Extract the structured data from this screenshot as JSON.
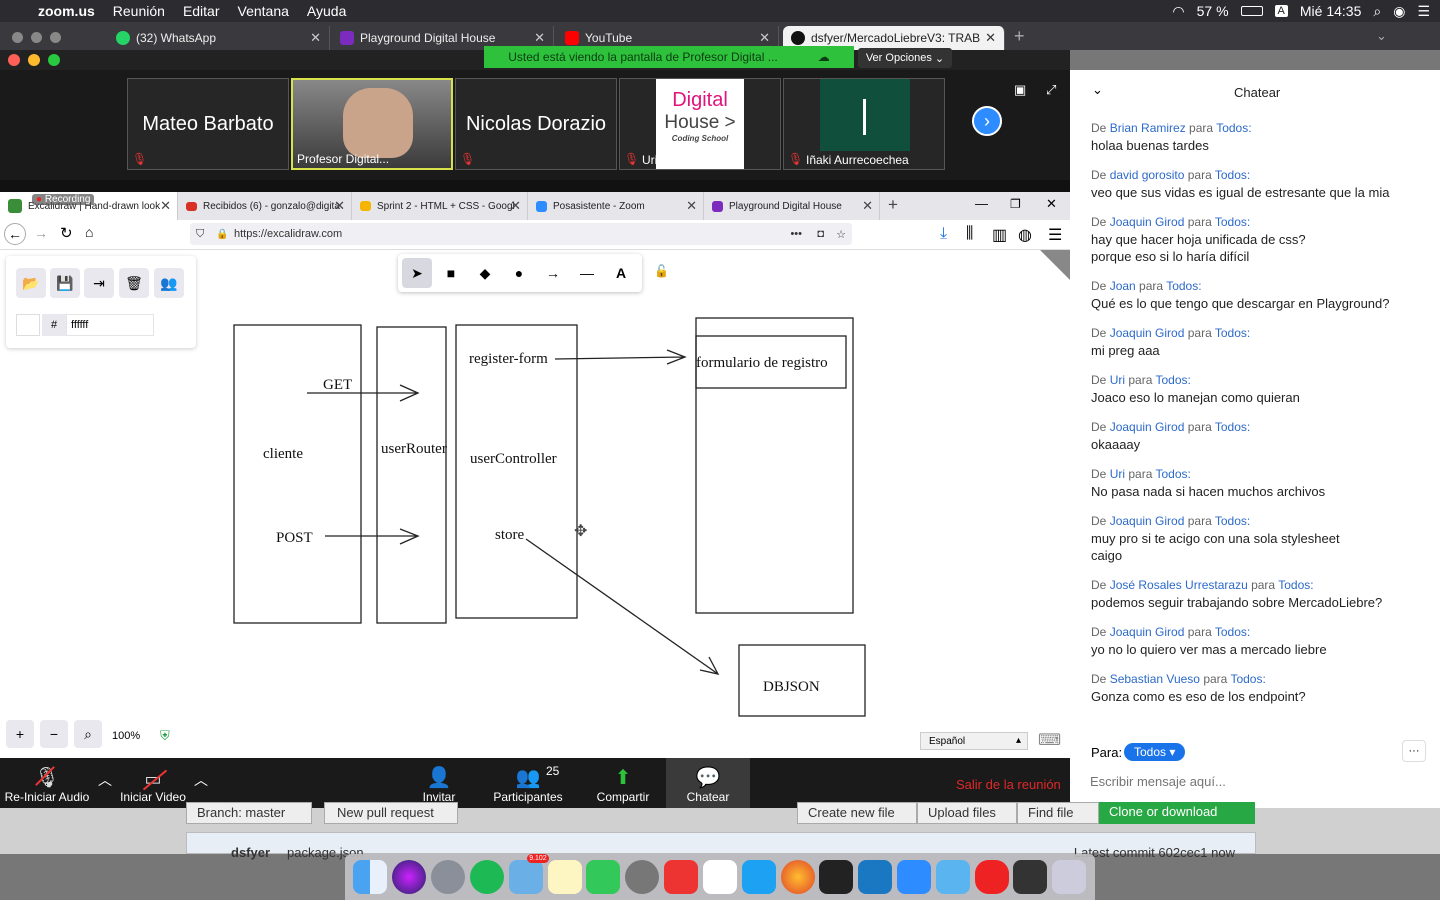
{
  "menubar": {
    "app": "zoom.us",
    "items": [
      "Reunión",
      "Editar",
      "Ventana",
      "Ayuda"
    ],
    "battery": "57 %",
    "clock": "Mié 14:35",
    "input_lang": "A"
  },
  "chrome_tabs": [
    {
      "label": "(32) WhatsApp",
      "badge": "32",
      "color": "#25d366"
    },
    {
      "label": "Playground Digital House",
      "color": "#7b2cbf"
    },
    {
      "label": "YouTube",
      "color": "#ff0000"
    },
    {
      "label": "dsfyer/MercadoLiebreV3: TRAB",
      "color": "#111111"
    }
  ],
  "zoom": {
    "share_banner": "Usted está viendo la pantalla de Profesor Digital ...",
    "view_options": "Ver Opciones"
  },
  "participants": [
    {
      "name": "Mateo Barbato",
      "label": ""
    },
    {
      "name": "",
      "label": "Profesor Digital..."
    },
    {
      "name": "Nicolas Dorazio",
      "label": ""
    },
    {
      "name": "",
      "label": "Uri",
      "logo": "Digital House > Coding School"
    },
    {
      "name": "",
      "label": "Iñaki Aurrecoechea"
    }
  ],
  "dh_logo": {
    "line1": "Digital",
    "line2": "House >",
    "line3": "Coding School"
  },
  "firefox": {
    "tabs": [
      {
        "label": "Excalidraw | Hand-drawn look"
      },
      {
        "label": "Recibidos (6) - gonzalo@digita"
      },
      {
        "label": "Sprint 2 - HTML + CSS - Googl"
      },
      {
        "label": "Posasistente - Zoom"
      },
      {
        "label": "Playground Digital House"
      }
    ],
    "recording": "Recording",
    "url": "https://excalidraw.com"
  },
  "excalidraw": {
    "color_value": "ffffff",
    "hash": "#",
    "zoom": "100%",
    "language": "Español",
    "shape_tools": [
      "selection",
      "rectangle",
      "diamond",
      "ellipse",
      "arrow",
      "line",
      "text"
    ],
    "labels": {
      "get": "GET",
      "cliente": "cliente",
      "post": "POST",
      "userRouter": "userRouter",
      "register_form": "register-form",
      "userController": "userController",
      "store": "store",
      "formulario": "formulario de registro",
      "dbjson": "DBJSON"
    }
  },
  "zoom_toolbar": {
    "audio": "Re-Iniciar Audio",
    "video": "Iniciar Video",
    "invite": "Invitar",
    "participants": "Participantes",
    "participants_count": "25",
    "share": "Compartir",
    "chat": "Chatear",
    "leave": "Salir de la reunión"
  },
  "chat": {
    "title": "Chatear",
    "messages": [
      {
        "pre": "De ",
        "from": "Brian Ramirez",
        "mid": " para ",
        "to": "Todos:",
        "text": "holaa buenas tardes"
      },
      {
        "pre": "De ",
        "from": "david gorosito",
        "mid": " para ",
        "to": "Todos:",
        "text": "veo que sus vidas es igual de estresante que la mia"
      },
      {
        "pre": "De ",
        "from": "Joaquin Girod",
        "mid": " para ",
        "to": "Todos:",
        "text": "hay que hacer hoja unificada de css?",
        "text2": "porque eso si lo haría difícil"
      },
      {
        "pre": "De ",
        "from": "Joan",
        "mid": " para ",
        "to": "Todos:",
        "text": "Qué es lo que tengo que descargar en Playground?"
      },
      {
        "pre": "De ",
        "from": "Joaquin Girod",
        "mid": " para ",
        "to": "Todos:",
        "text": "mi preg aaa"
      },
      {
        "pre": "De ",
        "from": "Uri",
        "mid": " para ",
        "to": "Todos:",
        "text": "Joaco eso lo manejan como quieran"
      },
      {
        "pre": "De ",
        "from": "Joaquin Girod",
        "mid": " para ",
        "to": "Todos:",
        "text": "okaaaay"
      },
      {
        "pre": "De ",
        "from": "Uri",
        "mid": " para ",
        "to": "Todos:",
        "text": "No pasa nada si hacen muchos archivos"
      },
      {
        "pre": "De ",
        "from": "Joaquin Girod",
        "mid": " para ",
        "to": "Todos:",
        "text": "muy pro si te acigo con una sola stylesheet",
        "text2": "caigo"
      },
      {
        "pre": "De ",
        "from": "José Rosales Urrestarazu",
        "mid": " para ",
        "to": "Todos:",
        "text": "podemos seguir trabajando sobre MercadoLiebre?"
      },
      {
        "pre": "De ",
        "from": "Joaquin Girod",
        "mid": " para ",
        "to": "Todos:",
        "text": "yo no lo quiero ver mas a mercado liebre"
      },
      {
        "pre": "De ",
        "from": "Sebastian Vueso",
        "mid": " para ",
        "to": "Todos:",
        "text": "Gonza como es eso de los endpoint?"
      }
    ],
    "to_label": "Para:",
    "to_value": "Todos",
    "placeholder": "Escribir mensaje aquí..."
  },
  "github_behind": {
    "branch": "Branch: master",
    "new_pr": "New pull request",
    "create": "Create new file",
    "upload": "Upload files",
    "find": "Find file",
    "clone": "Clone or download",
    "user": "dsfyer",
    "file": "package.json",
    "commit": "Latest commit 602cec1 now"
  },
  "dock": {
    "badge": "9.102"
  }
}
